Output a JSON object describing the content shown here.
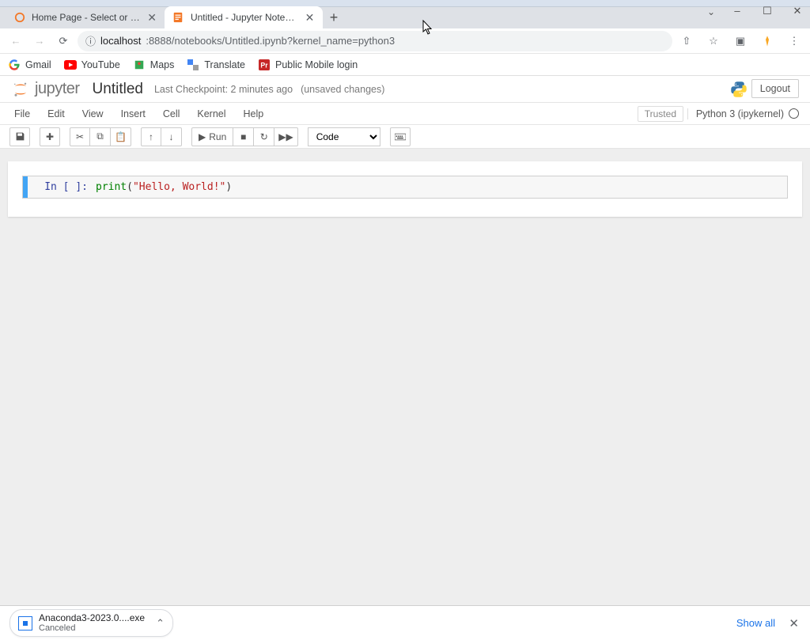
{
  "window": {
    "minimize": "–",
    "maximize": "☐",
    "close": "✕",
    "chevron": "⌄"
  },
  "tabs": [
    {
      "title": "Home Page - Select or create a n…",
      "active": false
    },
    {
      "title": "Untitled - Jupyter Notebook",
      "active": true
    }
  ],
  "address": {
    "host": "localhost",
    "rest": ":8888/notebooks/Untitled.ipynb?kernel_name=python3"
  },
  "bookmarks": [
    {
      "label": "Gmail"
    },
    {
      "label": "YouTube"
    },
    {
      "label": "Maps"
    },
    {
      "label": "Translate"
    },
    {
      "label": "Public Mobile login"
    }
  ],
  "jupyter": {
    "logo_text": "jupyter",
    "title": "Untitled",
    "checkpoint": "Last Checkpoint: 2 minutes ago",
    "unsaved": "(unsaved changes)",
    "logout": "Logout"
  },
  "menu": {
    "items": [
      "File",
      "Edit",
      "View",
      "Insert",
      "Cell",
      "Kernel",
      "Help"
    ],
    "trusted": "Trusted",
    "kernel": "Python 3 (ipykernel)"
  },
  "toolbar": {
    "run_label": "Run",
    "cell_type": "Code"
  },
  "cell": {
    "prompt": "In [ ]:",
    "code_kw": "print",
    "code_open": "(",
    "code_str": "\"Hello, World!\"",
    "code_close": ")"
  },
  "download": {
    "name": "Anaconda3-2023.0....exe",
    "status": "Canceled",
    "showall": "Show all"
  }
}
